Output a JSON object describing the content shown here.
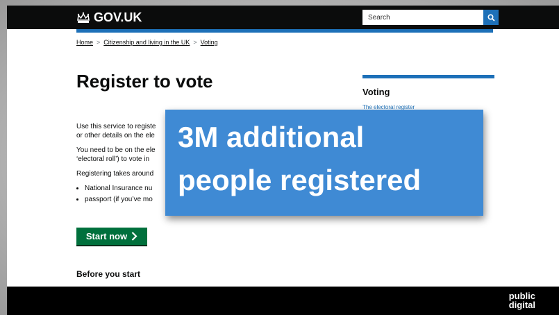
{
  "header": {
    "logo_text": "GOV.UK",
    "logo_icon": "crown-icon",
    "search": {
      "placeholder": "Search",
      "button_icon": "search-icon"
    }
  },
  "breadcrumb": {
    "items": [
      "Home",
      "Citizenship and living in the UK",
      "Voting"
    ],
    "separator": ">"
  },
  "page": {
    "title": "Register to vote",
    "intro": {
      "p1_line1": "Use this service to registe",
      "p1_line2": "or other details on the ele",
      "p2_line1": "You need to be on the ele",
      "p2_line2": "‘electoral roll’) to vote in",
      "p3": "Registering takes around",
      "bullets": [
        "National Insurance nu",
        "passport (if you’ve mo"
      ]
    },
    "start_button": {
      "label": "Start now",
      "icon": "chevron-right-icon"
    },
    "before_you_start": "Before you start"
  },
  "related": {
    "title": "Voting",
    "link": "The electoral register"
  },
  "callout": {
    "line1": "3M additional",
    "line2": "people registered"
  },
  "footer": {
    "brand_line1": "public",
    "brand_line2": "digital"
  },
  "colors": {
    "header_bg": "#0b0c0c",
    "link_blue": "#1d70b8",
    "button_green": "#00703c",
    "callout_blue": "#3f8ad4",
    "footer_bg": "#000000"
  }
}
